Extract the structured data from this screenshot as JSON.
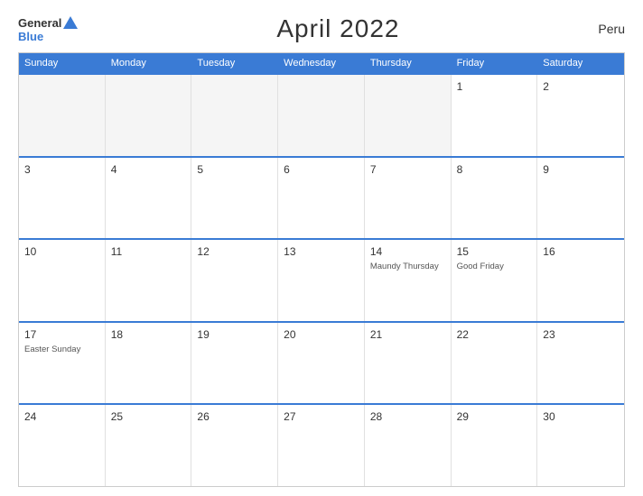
{
  "header": {
    "logo_general": "General",
    "logo_blue": "Blue",
    "title": "April 2022",
    "country": "Peru"
  },
  "calendar": {
    "day_headers": [
      "Sunday",
      "Monday",
      "Tuesday",
      "Wednesday",
      "Thursday",
      "Friday",
      "Saturday"
    ],
    "weeks": [
      [
        {
          "num": "",
          "empty": true
        },
        {
          "num": "",
          "empty": true
        },
        {
          "num": "",
          "empty": true
        },
        {
          "num": "",
          "empty": true
        },
        {
          "num": "",
          "empty": true
        },
        {
          "num": "1",
          "event": ""
        },
        {
          "num": "2",
          "event": ""
        }
      ],
      [
        {
          "num": "3",
          "event": ""
        },
        {
          "num": "4",
          "event": ""
        },
        {
          "num": "5",
          "event": ""
        },
        {
          "num": "6",
          "event": ""
        },
        {
          "num": "7",
          "event": ""
        },
        {
          "num": "8",
          "event": ""
        },
        {
          "num": "9",
          "event": ""
        }
      ],
      [
        {
          "num": "10",
          "event": ""
        },
        {
          "num": "11",
          "event": ""
        },
        {
          "num": "12",
          "event": ""
        },
        {
          "num": "13",
          "event": ""
        },
        {
          "num": "14",
          "event": "Maundy Thursday"
        },
        {
          "num": "15",
          "event": "Good Friday"
        },
        {
          "num": "16",
          "event": ""
        }
      ],
      [
        {
          "num": "17",
          "event": "Easter Sunday"
        },
        {
          "num": "18",
          "event": ""
        },
        {
          "num": "19",
          "event": ""
        },
        {
          "num": "20",
          "event": ""
        },
        {
          "num": "21",
          "event": ""
        },
        {
          "num": "22",
          "event": ""
        },
        {
          "num": "23",
          "event": ""
        }
      ],
      [
        {
          "num": "24",
          "event": ""
        },
        {
          "num": "25",
          "event": ""
        },
        {
          "num": "26",
          "event": ""
        },
        {
          "num": "27",
          "event": ""
        },
        {
          "num": "28",
          "event": ""
        },
        {
          "num": "29",
          "event": ""
        },
        {
          "num": "30",
          "event": ""
        }
      ]
    ]
  }
}
